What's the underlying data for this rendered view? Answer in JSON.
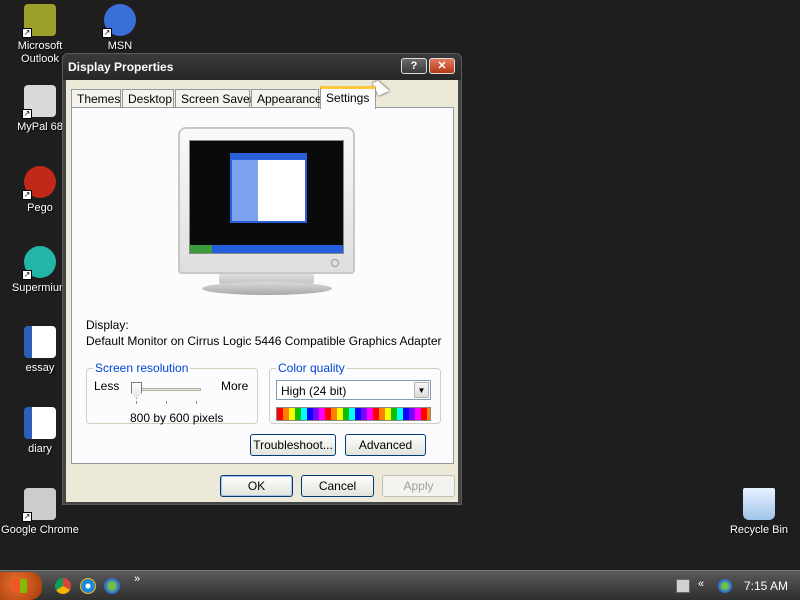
{
  "desktop": {
    "icons": [
      {
        "label": "Microsoft\nOutlook",
        "icon": "outlook-icon",
        "color": "#9aa02a"
      },
      {
        "label": "MSN",
        "icon": "msn-butterfly-icon",
        "color": "#3b6fd8"
      },
      {
        "label": "MyPal 68",
        "icon": "mypal-icon",
        "color": "#d9d9d9"
      },
      {
        "label": "Pego",
        "icon": "pego-icon",
        "color": "#c0281a"
      },
      {
        "label": "Supermium",
        "icon": "supermium-icon",
        "color": "#22b5a8"
      },
      {
        "label": "essay",
        "icon": "word-document-icon",
        "color": "#2b5fb8"
      },
      {
        "label": "diary",
        "icon": "word-document-icon",
        "color": "#2b5fb8"
      },
      {
        "label": "Google Chrome",
        "icon": "chrome-icon",
        "color": "#cccccc"
      },
      {
        "label": "Recycle Bin",
        "icon": "recycle-bin-icon",
        "color": "#3a9a3a"
      }
    ]
  },
  "window": {
    "title": "Display Properties",
    "help_label": "?",
    "close_label": "✕",
    "tabs": [
      {
        "label": "Themes"
      },
      {
        "label": "Desktop"
      },
      {
        "label": "Screen Saver"
      },
      {
        "label": "Appearance"
      },
      {
        "label": "Settings",
        "active": true
      }
    ],
    "display_label": "Display:",
    "display_value": "Default Monitor on Cirrus Logic 5446 Compatible Graphics Adapter",
    "resolution": {
      "legend": "Screen resolution",
      "less_label": "Less",
      "more_label": "More",
      "value_text": "800 by 600 pixels",
      "slider_level": 0
    },
    "color_quality": {
      "legend": "Color quality",
      "selected": "High (24 bit)"
    },
    "troubleshoot_label": "Troubleshoot...",
    "advanced_label": "Advanced",
    "ok_label": "OK",
    "cancel_label": "Cancel",
    "apply_label": "Apply"
  },
  "taskbar": {
    "chevron_label": "»",
    "tray_chevron_label": "«",
    "clock": "7:15 AM",
    "quick_launch": [
      "chrome-icon",
      "internet-explorer-icon",
      "msn-icon"
    ]
  },
  "colors": {
    "desktop_bg": "#1e1e1e",
    "legend_blue": "#0046d5",
    "active_tab_accent": "#ffc83c"
  }
}
